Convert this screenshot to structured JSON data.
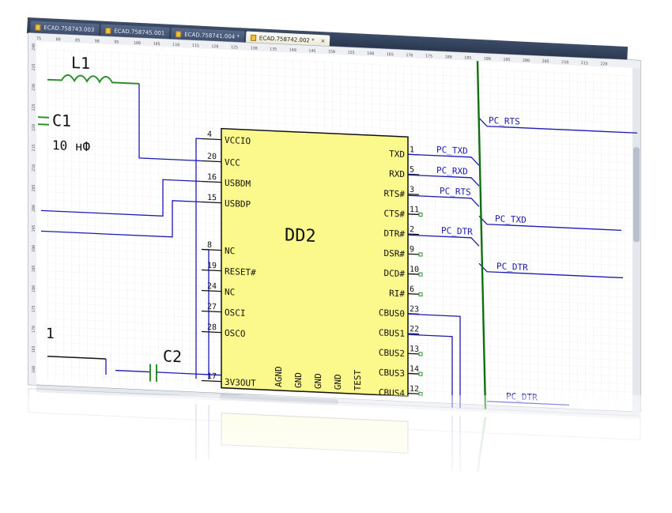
{
  "tabs": [
    {
      "label": "ECAD.758743.003",
      "active": false
    },
    {
      "label": "ECAD.758745.001",
      "active": false
    },
    {
      "label": "ECAD.758741.004 *",
      "active": false
    },
    {
      "label": "ECAD.758742.002 *",
      "active": true
    }
  ],
  "ruler_top": [
    "75",
    "80",
    "85",
    "90",
    "95",
    "100",
    "105",
    "110",
    "115",
    "120",
    "125",
    "130",
    "135",
    "140",
    "145",
    "150",
    "155",
    "160",
    "165",
    "170",
    "175",
    "180",
    "185",
    "190",
    "195",
    "200",
    "205",
    "210",
    "215",
    "220"
  ],
  "ruler_left": [
    "240",
    "235",
    "230",
    "225",
    "220",
    "215",
    "210",
    "205",
    "200",
    "195",
    "190",
    "185",
    "180",
    "175",
    "170",
    "165",
    "160"
  ],
  "components": {
    "inductor": "L1",
    "cap1": "C1",
    "cap1_value": "10 нФ",
    "cap2": "C2",
    "misc": "1",
    "chip": "DD2"
  },
  "chip_left_pins": [
    {
      "num": "4",
      "name": "VCCIO"
    },
    {
      "num": "20",
      "name": "VCC"
    },
    {
      "num": "16",
      "name": "USBDM"
    },
    {
      "num": "15",
      "name": "USBDP"
    },
    {
      "num": "8",
      "name": "NC"
    },
    {
      "num": "19",
      "name": "RESET#"
    },
    {
      "num": "24",
      "name": "NC"
    },
    {
      "num": "27",
      "name": "OSCI"
    },
    {
      "num": "28",
      "name": "OSCO"
    },
    {
      "num": "17",
      "name": "3V3OUT"
    }
  ],
  "chip_right_pins": [
    {
      "num": "1",
      "name": "TXD"
    },
    {
      "num": "5",
      "name": "RXD"
    },
    {
      "num": "3",
      "name": "RTS#"
    },
    {
      "num": "11",
      "name": "CTS#"
    },
    {
      "num": "2",
      "name": "DTR#"
    },
    {
      "num": "9",
      "name": "DSR#"
    },
    {
      "num": "10",
      "name": "DCD#"
    },
    {
      "num": "6",
      "name": "RI#"
    },
    {
      "num": "23",
      "name": "CBUS0"
    },
    {
      "num": "22",
      "name": "CBUS1"
    },
    {
      "num": "13",
      "name": "CBUS2"
    },
    {
      "num": "14",
      "name": "CBUS3"
    },
    {
      "num": "12",
      "name": "CBUS4"
    }
  ],
  "chip_bottom_pins": [
    "AGND",
    "GND",
    "GND",
    "GND",
    "TEST"
  ],
  "nets": {
    "pc_txd": "PC_TXD",
    "pc_rxd": "PC_RXD",
    "pc_rts": "PC_RTS",
    "pc_dtr": "PC_DTR",
    "bus_rts": "PC_RTS",
    "bus_txd": "PC_TXD",
    "bus_dtr": "PC_DTR",
    "bus_cut": "PC_DTR"
  },
  "colors": {
    "wire": "#1a1ab4",
    "bus": "#107010",
    "chip_fill": "#fbf98c",
    "pin_end": "#2d8f2d",
    "grid": "#e3e6ec"
  }
}
